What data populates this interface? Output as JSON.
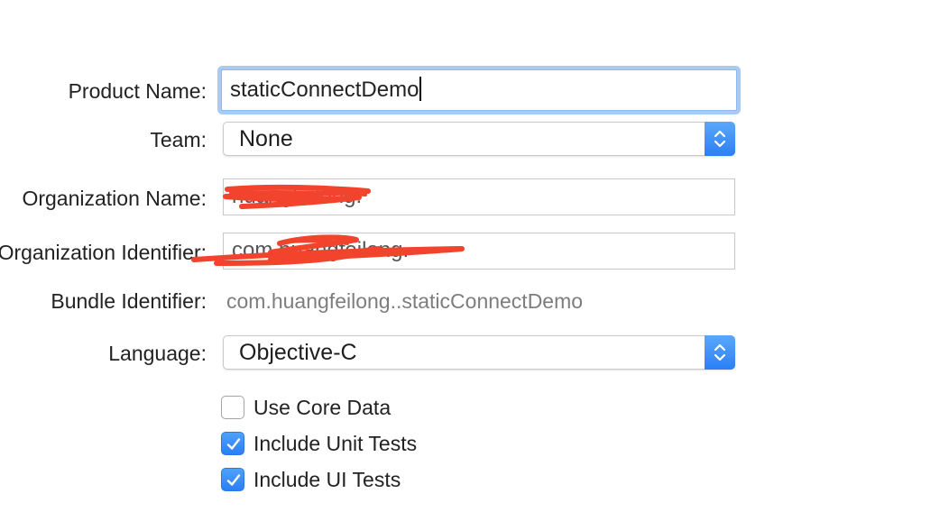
{
  "form": {
    "product_name": {
      "label": "Product Name:",
      "value": "staticConnectDemo"
    },
    "team": {
      "label": "Team:",
      "value": "None"
    },
    "organization_name": {
      "label": "Organization Name:",
      "value": "huangfeilong."
    },
    "organization_identifier": {
      "label": "Organization Identifier:",
      "value": "com.huangfeilong."
    },
    "bundle_identifier": {
      "label": "Bundle Identifier:",
      "value": "com.huangfeilong..staticConnectDemo"
    },
    "language": {
      "label": "Language:",
      "value": "Objective-C"
    },
    "options": [
      {
        "label": "Use Core Data",
        "checked": false
      },
      {
        "label": "Include Unit Tests",
        "checked": true
      },
      {
        "label": "Include UI Tests",
        "checked": true
      }
    ]
  },
  "icons": {
    "popup_stepper": "chevron-up-down-icon",
    "checkbox_check": "checkmark-icon"
  },
  "colors": {
    "accent": "#2c7ff6",
    "focus_ring": "#a9caf3",
    "redaction": "#f2432c",
    "secondary_text": "#7d7d7d"
  }
}
